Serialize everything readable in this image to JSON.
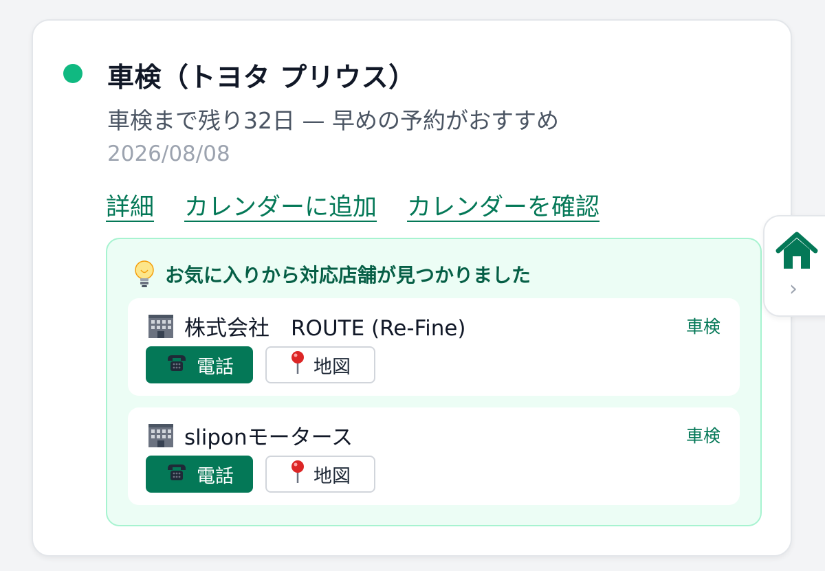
{
  "reminder": {
    "status_color": "#10b981",
    "title": "車検（トヨタ プリウス）",
    "subtitle": "車検まで残り32日 — 早めの予約がおすすめ",
    "date": "2026/08/08",
    "links": {
      "details": "詳細",
      "add_calendar": "カレンダーに追加",
      "check_calendar": "カレンダーを確認"
    }
  },
  "suggestion": {
    "icon": "lightbulb-icon",
    "title": "お気に入りから対応店舗が見つかりました",
    "shops": [
      {
        "icon": "building-icon",
        "name": "株式会社　ROUTE (Re-Fine)",
        "tag": "車検",
        "call_label": "電話",
        "call_icon": "phone-icon",
        "map_label": "地図",
        "map_icon": "map-pin-icon"
      },
      {
        "icon": "building-icon",
        "name": "sliponモータース",
        "tag": "車検",
        "call_label": "電話",
        "call_icon": "phone-icon",
        "map_label": "地図",
        "map_icon": "map-pin-icon"
      }
    ]
  },
  "side_tab": {
    "icon": "home-icon",
    "chevron": "›"
  },
  "colors": {
    "accent": "#047857",
    "panel_bg": "#ecfdf5",
    "panel_border": "#a7f3d0"
  }
}
